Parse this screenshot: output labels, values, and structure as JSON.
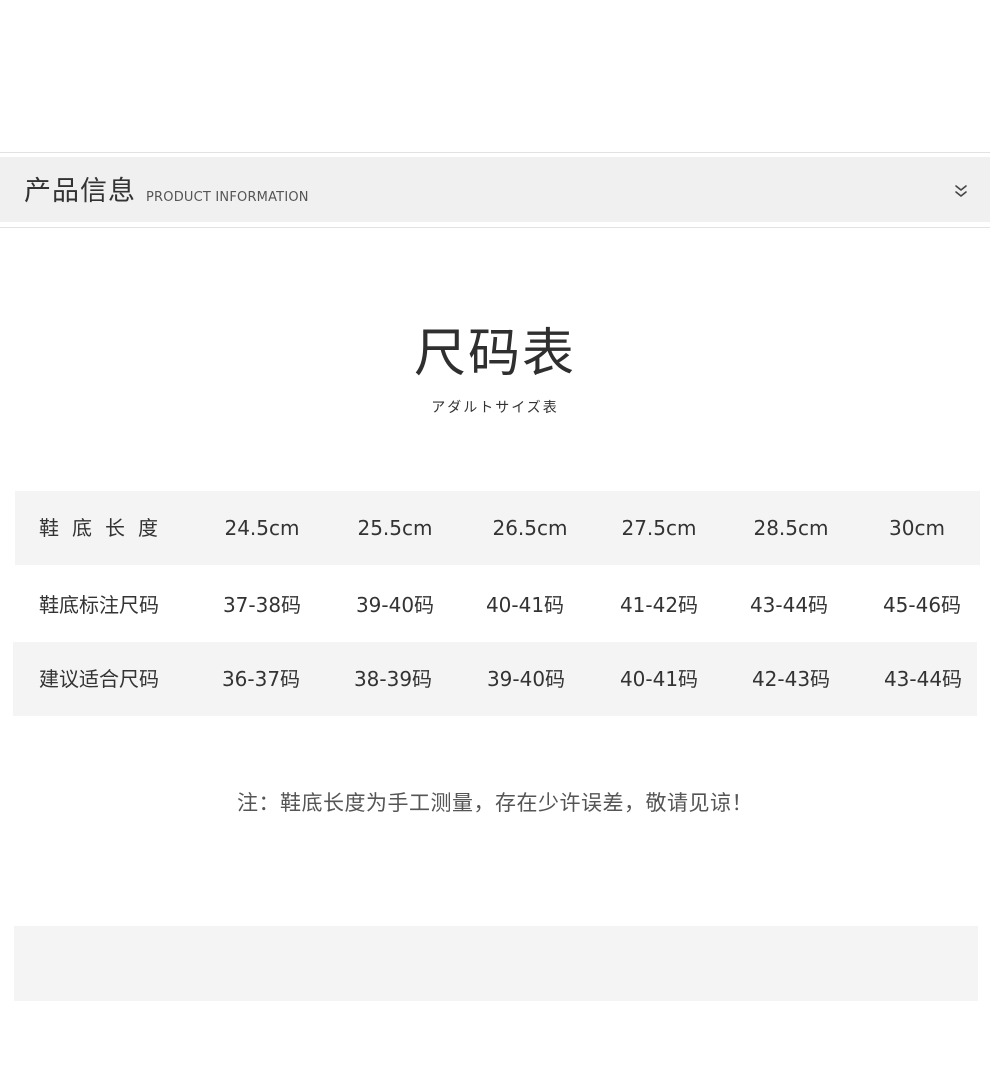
{
  "header": {
    "title": "产品信息",
    "subtitle": "PRODUCT INFORMATION",
    "toggle_icon": "double-chevron-down-icon"
  },
  "size_chart": {
    "title": "尺码表",
    "subtitle": "アダルトサイズ表",
    "rows": [
      {
        "label": "鞋底长度",
        "values": [
          "24.5cm",
          "25.5cm",
          "26.5cm",
          "27.5cm",
          "28.5cm",
          "30cm"
        ]
      },
      {
        "label": "鞋底标注尺码",
        "values": [
          "37-38码",
          "39-40码",
          "40-41码",
          "41-42码",
          "43-44码",
          "45-46码"
        ]
      },
      {
        "label": "建议适合尺码",
        "values": [
          "36-37码",
          "38-39码",
          "39-40码",
          "40-41码",
          "42-43码",
          "43-44码"
        ]
      }
    ]
  },
  "note": "注：鞋底长度为手工测量，存在少许误差，敬请见谅！",
  "colors": {
    "header_bg": "#f0f0f0",
    "row_shade": "#f4f4f4",
    "text": "#333333"
  }
}
